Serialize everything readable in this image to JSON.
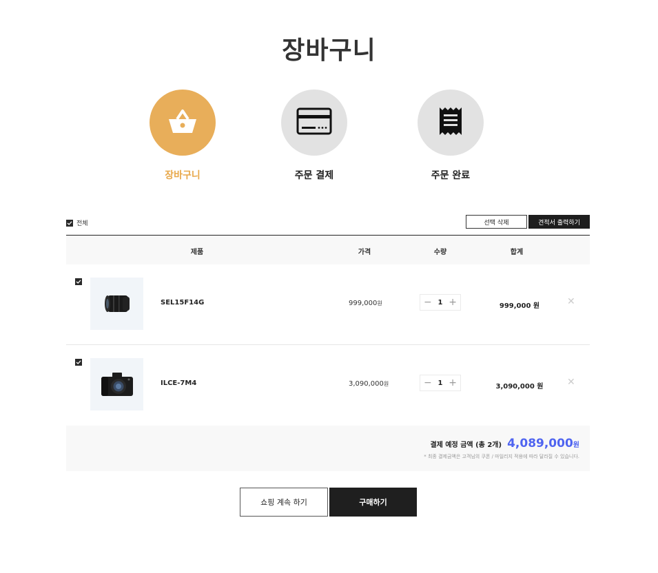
{
  "page_title": "장바구니",
  "steps": [
    {
      "label": "장바구니",
      "icon": "basket-icon",
      "active": true
    },
    {
      "label": "주문 결제",
      "icon": "credit-card-icon",
      "active": false
    },
    {
      "label": "주문 완료",
      "icon": "receipt-icon",
      "active": false
    }
  ],
  "toolbar": {
    "select_all_label": "전체",
    "delete_selected_label": "선택 삭제",
    "print_estimate_label": "견적서 출력하기"
  },
  "table": {
    "headers": [
      "제품",
      "가격",
      "수량",
      "합계"
    ],
    "rows": [
      {
        "checked": true,
        "name": "SEL15F14G",
        "price": "999,000",
        "price_unit": "원",
        "qty": "1",
        "total": "999,000 원",
        "image": "camera-lens"
      },
      {
        "checked": true,
        "name": "ILCE-7M4",
        "price": "3,090,000",
        "price_unit": "원",
        "qty": "1",
        "total": "3,090,000 원",
        "image": "camera-body"
      }
    ]
  },
  "summary": {
    "label": "결제 예정 금액 (총 2개)",
    "amount": "4,089,000",
    "unit": "원",
    "note": "* 최종 결제금액은 고객님의 쿠폰 / 마일리지 적용에 따라 달라질 수 있습니다."
  },
  "actions": {
    "continue_label": "쇼핑 계속 하기",
    "buy_label": "구매하기"
  },
  "colors": {
    "accent": "#e8ae5a",
    "amount": "#4f64f0",
    "dark": "#1f1f1f"
  }
}
